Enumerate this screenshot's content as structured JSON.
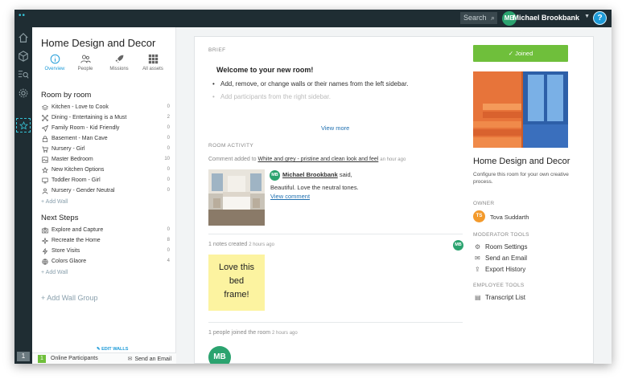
{
  "topbar": {
    "search_placeholder": "Search",
    "user_initials": "MB",
    "user_name": "Michael Brookbank",
    "help": "?"
  },
  "rail": {
    "badge": "1"
  },
  "sidebar": {
    "title": "Home Design and Decor",
    "nav": [
      {
        "label": "Overview",
        "icon": "info-icon"
      },
      {
        "label": "People",
        "icon": "people-icon"
      },
      {
        "label": "Missions",
        "icon": "rocket-icon"
      },
      {
        "label": "All assets",
        "icon": "grid-icon"
      }
    ],
    "room_by_room": {
      "heading": "Room by room",
      "items": [
        {
          "label": "Kitchen - Love to Cook",
          "count": "0"
        },
        {
          "label": "Dining - Entertaining is a Must",
          "count": "2"
        },
        {
          "label": "Family Room - Kid Friendly",
          "count": "0"
        },
        {
          "label": "Basement - Man Cave",
          "count": "0"
        },
        {
          "label": "Nursery - Girl",
          "count": "0"
        },
        {
          "label": "Master Bedroom",
          "count": "10"
        },
        {
          "label": "New Kitchen Options",
          "count": "0"
        },
        {
          "label": "Toddler Room - Girl",
          "count": "0"
        },
        {
          "label": "Nursery - Gender Neutral",
          "count": "0"
        }
      ],
      "add": "+ Add Wall"
    },
    "next_steps": {
      "heading": "Next Steps",
      "items": [
        {
          "label": "Explore and Capture",
          "count": "0"
        },
        {
          "label": "Recreate the Home",
          "count": "8"
        },
        {
          "label": "Store Visits",
          "count": "0"
        },
        {
          "label": "Colors Glaore",
          "count": "4"
        }
      ],
      "add": "+ Add Wall"
    },
    "add_group": "+ Add Wall Group",
    "edit_walls": "EDIT WALLS",
    "footer": {
      "online_count": "1",
      "online_label": "Online Participants",
      "send_email": "Send an Email"
    }
  },
  "main": {
    "brief_label": "BRIEF",
    "welcome": "Welcome to your new room!",
    "bullets": [
      "Add, remove, or change walls or their names from the left sidebar.",
      "Add participants from the right sidebar."
    ],
    "view_more": "View more",
    "activity_label": "ROOM ACTIVITY",
    "comment": {
      "prefix": "Comment added to ",
      "wall": "White and grey - pristine and clean look and feel",
      "time": "an hour ago",
      "initials": "MB",
      "author": "Michael Brookbank",
      "said": " said,",
      "text": "Beautiful. Love the neutral tones.",
      "view": "View comment"
    },
    "notes": {
      "text": "1 notes created",
      "time": "2 hours ago",
      "initials": "MB",
      "sticky_lines": [
        "Love this",
        "bed",
        "frame!"
      ]
    },
    "joined": {
      "text": "1 people joined the room",
      "time": "2 hours ago",
      "initials": "MB"
    }
  },
  "right": {
    "joined_button": "Joined",
    "room_title": "Home Design and Decor",
    "room_desc": "Configure this room for your own creative process.",
    "owner_label": "OWNER",
    "owner_initials": "TS",
    "owner_name": "Tova Suddarth",
    "moderator_label": "MODERATOR TOOLS",
    "moderator_tools": [
      "Room Settings",
      "Send an Email",
      "Export History"
    ],
    "employee_label": "EMPLOYEE TOOLS",
    "employee_tools": [
      "Transcript List"
    ]
  },
  "colors": {
    "dark": "#1f2d33",
    "accent": "#1e9bd8",
    "green": "#6fbf3b",
    "avatar_green": "#2ba36f",
    "owner_orange": "#f39a2c"
  }
}
